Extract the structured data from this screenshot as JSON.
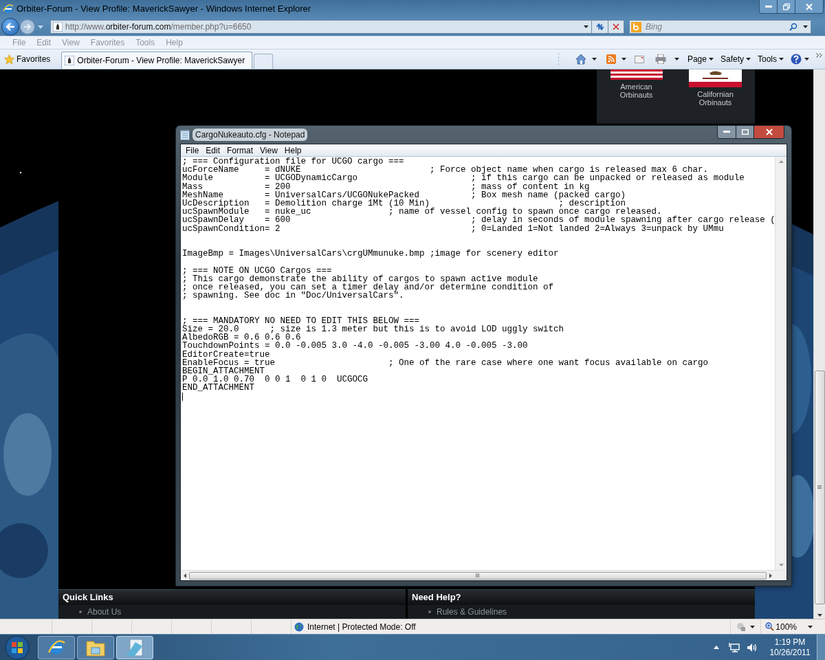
{
  "browser": {
    "title": "Orbiter-Forum - View Profile: MaverickSawyer - Windows Internet Explorer",
    "address": "http://www.**orbiter-forum.com**/member.php?u=6650",
    "search": {
      "placeholder": "Bing"
    },
    "menu": [
      "File",
      "Edit",
      "View",
      "Favorites",
      "Tools",
      "Help"
    ],
    "favorites_label": "Favorites",
    "tabs": [
      {
        "label": "Orbiter-Forum - View Profile: MaverickSawyer",
        "selected": true
      }
    ],
    "command_bar": [
      "Page",
      "Safety",
      "Tools"
    ]
  },
  "page": {
    "groups": [
      {
        "label": "American Orbinauts",
        "kind": "us"
      },
      {
        "label": "Californian Orbinauts",
        "kind": "ca"
      }
    ],
    "sections": [
      {
        "title": "Quick Links",
        "items": [
          "About Us"
        ]
      },
      {
        "title": "Need Help?",
        "items": [
          "Rules & Guidelines"
        ]
      }
    ]
  },
  "notepad": {
    "title": "CargoNukeauto.cfg - Notepad",
    "menu": [
      "File",
      "Edit",
      "Format",
      "View",
      "Help"
    ],
    "text": "; === Configuration file for UCGO cargo ===\nucForceName     = dNUKE                         ; Force object name when cargo is released max 6 char.\nModule          = UCGODynamicCargo                      ; if this cargo can be unpacked or released as module\nMass            = 200                                   ; mass of content in kg\nMeshName        = UniversalCars/UCGONukePacked          ; Box mesh name (packed cargo)\nUcDescription   = Demolition charge 1Mt (10 Min)                         ; description\nucSpawnModule   = nuke_uc               ; name of vessel config to spawn once cargo released.\nucSpawnDelay    = 600                                   ; delay in seconds of module spawning after cargo release (\nucSpawnCondition= 2                                     ; 0=Landed 1=Not landed 2=Always 3=unpack by UMmu\n\n\nImageBmp = Images\\UniversalCars\\crgUMmunuke.bmp ;image for scenery editor\n\n; === NOTE ON UCGO Cargos ===\n; This cargo demonstrate the ability of cargos to spawn active module\n; once released, you can set a timer delay and/or determine condition of\n; spawning. See doc in \"Doc/UniversalCars\".\n\n\n; === MANDATORY NO NEED TO EDIT THIS BELOW ===\nSize = 20.0      ; size is 1.3 meter but this is to avoid LOD uggly switch\nAlbedoRGB = 0.6 0.6 0.6\nTouchdownPoints = 0.0 -0.005 3.0 -4.0 -0.005 -3.00 4.0 -0.005 -3.00\nEditorCreate=true\nEnableFocus = true                      ; One of the rare case where one want focus available on cargo\nBEGIN_ATTACHMENT\nP 0.0 1.0 0.70  0 0 1  0 1 0  UCGOCG\nEND_ATTACHMENT"
  },
  "status_bar": {
    "zone": "Internet | Protected Mode: Off",
    "zoom": "100%"
  },
  "taskbar": {
    "apps": [
      {
        "kind": "ie",
        "selected": false
      },
      {
        "kind": "explorer",
        "selected": false
      },
      {
        "kind": "notepad",
        "selected": true
      }
    ],
    "time": "1:19 PM",
    "date": "10/26/2011"
  }
}
